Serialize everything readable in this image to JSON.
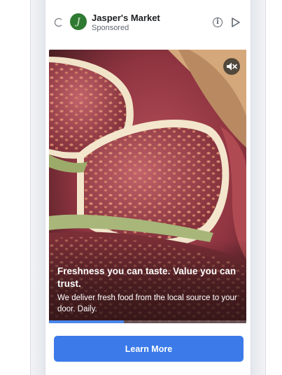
{
  "ad": {
    "advertiser": "Jasper's Market",
    "sponsored_label": "Sponsored",
    "avatar_glyph": "J",
    "headline": "Freshness you can taste. Value you can trust.",
    "description": "We deliver fresh food from the local source to your door. Daily.",
    "cta_label": "Learn More",
    "video_progress": 0.38
  },
  "icons": {
    "loading": "spinner-icon",
    "info": "info-icon",
    "share": "play-arrow-icon",
    "mute": "speaker-muted-icon"
  },
  "colors": {
    "brand_green": "#2f7a32",
    "cta_blue": "#3b7ae8",
    "progress_blue": "#4a86ee"
  }
}
